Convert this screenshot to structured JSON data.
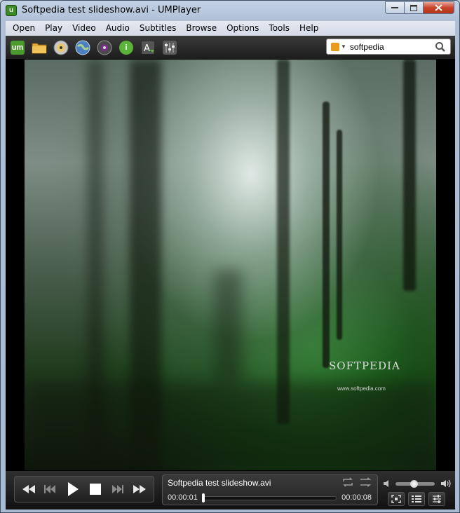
{
  "window": {
    "title": "Softpedia test slideshow.avi - UMPlayer",
    "app_icon": "um-logo-icon",
    "controls": [
      "minimize",
      "maximize",
      "close"
    ]
  },
  "menu": [
    "Open",
    "Play",
    "Video",
    "Audio",
    "Subtitles",
    "Browse",
    "Options",
    "Tools",
    "Help"
  ],
  "toolbar": {
    "buttons": [
      "um-logo-icon",
      "folder-icon",
      "disc-icon",
      "globe-icon",
      "webcam-icon",
      "info-icon",
      "subtitle-download-icon",
      "equalizer-icon"
    ],
    "search": {
      "value": "softpedia",
      "icon": "search-icon"
    }
  },
  "video": {
    "watermark_text": "SOFTPEDIA",
    "watermark_url": "www.softpedia.com"
  },
  "playback": {
    "filename": "Softpedia test slideshow.avi",
    "current_time": "00:00:01",
    "total_time": "00:00:08",
    "progress": 0.0,
    "volume": 0.55,
    "buttons": [
      "rewind-icon",
      "previous-icon",
      "play-icon",
      "stop-icon",
      "next-icon",
      "fast-forward-icon"
    ]
  },
  "colors": {
    "titlebar": "#c3d2e5",
    "toolbar_bg": "#2a2a2a",
    "close_button": "#c7442b"
  }
}
